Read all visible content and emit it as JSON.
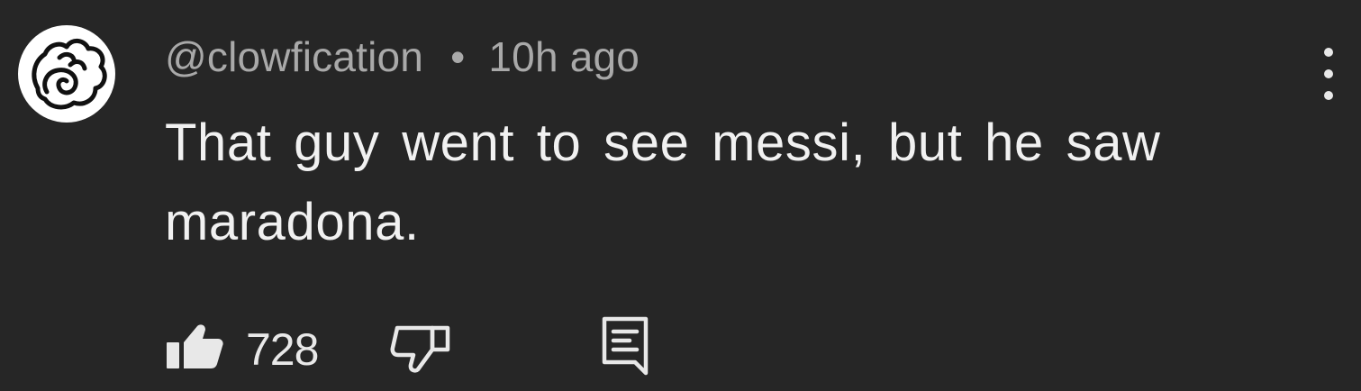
{
  "comment": {
    "author": "@clowfication",
    "separator": "•",
    "time": "10h ago",
    "text": "That guy went to see messi, but he saw maradona.",
    "like_count": "728"
  },
  "icons": {
    "avatar": "swirl-avatar-icon",
    "like": "thumbs-up-icon",
    "dislike": "thumbs-down-icon",
    "reply": "reply-comment-icon",
    "more": "more-vertical-icon"
  },
  "colors": {
    "background": "#262626",
    "meta_text": "#a9a9a9",
    "body_text": "#f1f1f1",
    "icon": "#e8e8e8"
  }
}
